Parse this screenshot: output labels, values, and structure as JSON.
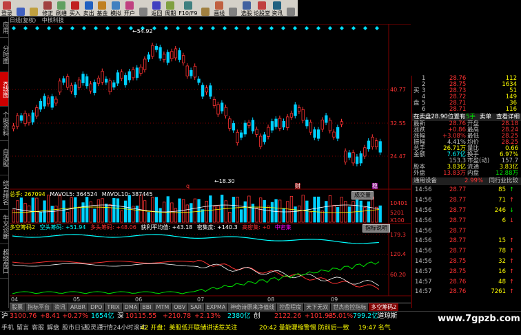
{
  "toolbar": {
    "items": [
      {
        "label": "登录",
        "color": "#c04040"
      },
      {
        "label": "",
        "color": "#4060c0"
      },
      {
        "label": "",
        "color": "#c0a040"
      },
      {
        "label": "修正",
        "color": "#a04040"
      },
      {
        "label": "刷缮",
        "color": "#60a060"
      },
      {
        "label": "买入",
        "color": "#c02020"
      },
      {
        "label": "卖出",
        "color": "#2060c0"
      },
      {
        "label": "基金",
        "color": "#c08020"
      },
      {
        "label": "模拟",
        "color": "#4080c0"
      },
      {
        "label": "开户",
        "color": "#c04080"
      },
      {
        "label": "",
        "color": "#808080"
      },
      {
        "label": "返回",
        "color": "#4040c0"
      },
      {
        "label": "周期",
        "color": "#80a040"
      },
      {
        "label": "F10/F9",
        "color": "#408080"
      },
      {
        "label": "",
        "color": "#a08040"
      },
      {
        "label": "画线",
        "color": "#c06040"
      },
      {
        "label": "",
        "color": "#808080"
      },
      {
        "label": "选股",
        "color": "#4060a0"
      },
      {
        "label": "论股堂",
        "color": "#c04040"
      },
      {
        "label": "资讯",
        "color": "#206080"
      },
      {
        "label": "",
        "color": "#808080"
      }
    ]
  },
  "title": {
    "period": "日线(复权)",
    "name": "中核科技"
  },
  "left_tabs": [
    "应用",
    "分时图",
    "K线图",
    "个股资料",
    "自选股",
    "综合排名",
    "牛叉诊断",
    "超级盘口"
  ],
  "active_left_tab": 2,
  "chart_data": {
    "type": "candlestick",
    "high_mark": "54.92",
    "low_mark": "18.30",
    "y_ticks": [
      "40.77",
      "32.55",
      "24.47"
    ],
    "vol_ticks": [
      "10401",
      "5201",
      "X100"
    ],
    "ind_ticks": [
      "179.3",
      "120.4",
      "60.20"
    ],
    "x_ticks": [
      "04",
      "05",
      "06",
      "07",
      "08",
      "09"
    ],
    "markers": [
      "q",
      "财",
      "稳"
    ]
  },
  "volume": {
    "label": "总手: 267094",
    "ma5": "MAVOL5: 364524",
    "ma10": "MAVOL10: 387445",
    "btn": "成交量"
  },
  "indicator": {
    "name": "多空筹码2",
    "v1": "空头筹码: +51.94",
    "v2": "多头筹码: +48.06",
    "v3": "获利平均值: +43.18",
    "v4": "密集度: +140.3",
    "v5": "高密集: +0",
    "v6": "中密集",
    "btn": "指标说明"
  },
  "bottom_tabs": [
    "股票",
    "指标平台",
    "资讯",
    "ARBR",
    "DPO",
    "TRIX",
    "DMA",
    "BBI",
    "MTM",
    "OBV",
    "SAR",
    "EXPMA",
    "神奇诗原来净值线",
    "控盘程度",
    "天下无双",
    "世杰密控指标",
    "多空筹码2"
  ],
  "quote": {
    "sells": [
      {
        "l": "",
        "p": "28.76",
        "v": "112"
      },
      {
        "l": "",
        "p": "28.75",
        "v": "1634"
      },
      {
        "l": "买",
        "p": "28.73",
        "v": "51"
      },
      {
        "l": "",
        "p": "28.72",
        "v": "149"
      },
      {
        "l": "盘",
        "p": "28.71",
        "v": "36"
      },
      {
        "l": "",
        "p": "28.71",
        "v": "116"
      }
    ],
    "bar": {
      "a": "在卖盘28.90位置有",
      "b": "5手",
      "c": "卖单",
      "d": "查看详细"
    },
    "fields": [
      {
        "k1": "最新",
        "v1": "28.76",
        "k2": "开盘",
        "v2": "28.18",
        "c1": "#ff3232",
        "c2": "#ff3232"
      },
      {
        "k1": "涨跌",
        "v1": "+0.86",
        "k2": "最高",
        "v2": "28.24",
        "c1": "#ff3232",
        "c2": "#ff3232"
      },
      {
        "k1": "涨幅",
        "v1": "+3.08%",
        "k2": "最低",
        "v2": "28.25",
        "c1": "#ff3232",
        "c2": "#ff3232"
      },
      {
        "k1": "振幅",
        "v1": "4.41%",
        "k2": "均价",
        "v2": "28.25",
        "c1": "#c0c0c0",
        "c2": "#ff3232"
      },
      {
        "k1": "总手",
        "v1": "26.71万",
        "k2": "量比",
        "v2": "0.66",
        "c1": "#ffff00",
        "c2": "#ffff00"
      },
      {
        "k1": "金额",
        "v1": "7.67亿",
        "k2": "换手",
        "v2": "6.97%",
        "c1": "#00ffff",
        "c2": "#ffff00"
      },
      {
        "k1": "",
        "v1": "153.3",
        "k2": "市盈(动)",
        "v2": "157.7",
        "c1": "#c0c0c0",
        "c2": "#c0c0c0"
      },
      {
        "k1": "股本",
        "v1": "3.83亿",
        "k2": "流通",
        "v2": "3.83亿",
        "c1": "#ffff00",
        "c2": "#ffff00"
      },
      {
        "k1": "外盘",
        "v1": "13.83万",
        "k2": "内盘",
        "v2": "12.88万",
        "c1": "#ff3232",
        "c2": "#00e600"
      }
    ],
    "tabs": {
      "a": "通用设备",
      "b": "2.99%",
      "c": "同行业比较"
    },
    "ticks": [
      {
        "t": "14:56",
        "p": "28.77",
        "v": "85",
        "d": "↑",
        "c": "#00e600"
      },
      {
        "t": "14:56",
        "p": "28.77",
        "v": "71",
        "d": "↑",
        "c": "#ff3232"
      },
      {
        "t": "14:56",
        "p": "28.77",
        "v": "246",
        "d": "↓",
        "c": "#00e600"
      },
      {
        "t": "14:56",
        "p": "28.77",
        "v": "6",
        "d": "↓",
        "c": "#ff3232"
      },
      {
        "t": "14:56",
        "p": "28.77",
        "v": "",
        "d": "",
        "c": "#ff3232"
      },
      {
        "t": "14:56",
        "p": "28.77",
        "v": "15",
        "d": "↑",
        "c": "#ff3232"
      },
      {
        "t": "14:56",
        "p": "28.77",
        "v": "78",
        "d": "↑",
        "c": "#ff3232"
      },
      {
        "t": "14:56",
        "p": "28.75",
        "v": "32",
        "d": "↑",
        "c": "#ff3232"
      },
      {
        "t": "14:57",
        "p": "28.75",
        "v": "16",
        "d": "↑",
        "c": "#ff3232"
      },
      {
        "t": "14:57",
        "p": "28.76",
        "v": "48",
        "d": "↑",
        "c": "#ff3232"
      },
      {
        "t": "14:57",
        "p": "28.76",
        "v": "7261",
        "d": "↑",
        "c": "#ff3232"
      }
    ]
  },
  "status1": {
    "a": "沪",
    "b": "3100.76",
    "c": "+8.41",
    "d": "+0.27%",
    "e": "1654亿",
    "f": "深",
    "g": "10115.55",
    "h": "+210.78",
    "i": "+2.13%",
    "j": "2380亿",
    "k": "创",
    "l": "2122.26",
    "m": "+101.93",
    "n": "+5.01%",
    "o": "799.2亿",
    "p": "道琼斯"
  },
  "status2": {
    "a": "手机",
    "b": "留言",
    "c": "客服",
    "d": "解盘",
    "e": "股市日记",
    "f": "股灵通",
    "g": "行情",
    "h": "24小时滚动",
    "i": "42 开盘：美股低开联储讲话惹关注",
    "j": "20:42 量能骤缩警惕 防前后一致",
    "k": "19:47 名气"
  },
  "watermark": "www.7gpzb.com"
}
